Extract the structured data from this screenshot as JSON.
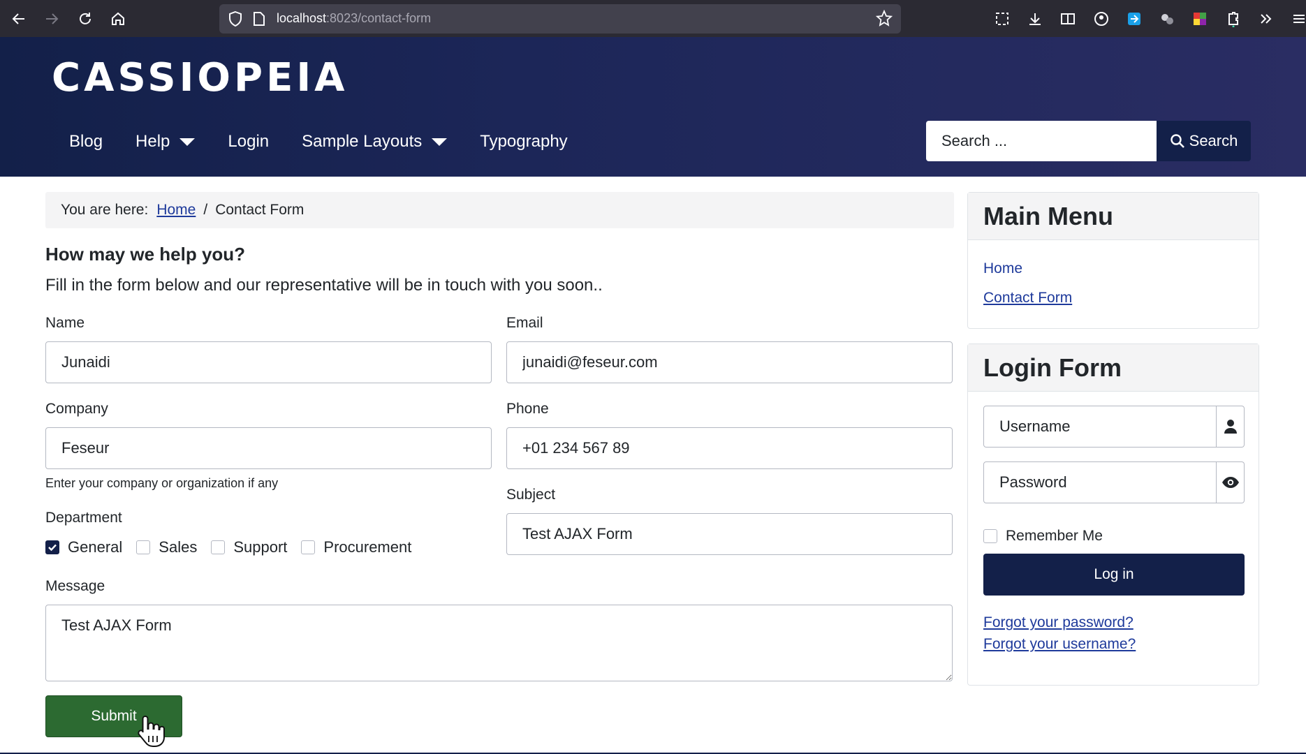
{
  "browser": {
    "url_host": "localhost",
    "url_rest": ":8023/contact-form"
  },
  "site": {
    "brand": "CASSIOPEIA",
    "nav": [
      "Blog",
      "Help",
      "Login",
      "Sample Layouts",
      "Typography"
    ],
    "search_placeholder": "Search ...",
    "search_button": "Search"
  },
  "breadcrumb": {
    "prefix": "You are here:",
    "home": "Home",
    "current": "Contact Form"
  },
  "form": {
    "heading": "How may we help you?",
    "intro": "Fill in the form below and our representative will be in touch with you soon..",
    "name_label": "Name",
    "name_value": "Junaidi",
    "email_label": "Email",
    "email_value": "junaidi@feseur.com",
    "company_label": "Company",
    "company_value": "Feseur",
    "company_hint": "Enter your company or organization if any",
    "phone_label": "Phone",
    "phone_value": "+01 234 567 89",
    "subject_label": "Subject",
    "subject_value": "Test AJAX Form",
    "department_label": "Department",
    "departments": [
      {
        "label": "General",
        "checked": true
      },
      {
        "label": "Sales",
        "checked": false
      },
      {
        "label": "Support",
        "checked": false
      },
      {
        "label": "Procurement",
        "checked": false
      }
    ],
    "message_label": "Message",
    "message_value": "Test AJAX Form",
    "submit_label": "Submit"
  },
  "sidebar": {
    "main_menu_title": "Main Menu",
    "main_menu_items": [
      "Home",
      "Contact Form"
    ],
    "login_title": "Login Form",
    "username_placeholder": "Username",
    "password_placeholder": "Password",
    "remember_label": "Remember Me",
    "login_button": "Log in",
    "forgot_password": "Forgot your password?",
    "forgot_username": "Forgot your username?"
  },
  "colors": {
    "header_bg": "#132049",
    "submit_bg": "#2c6a31",
    "link": "#1e3a9b"
  }
}
